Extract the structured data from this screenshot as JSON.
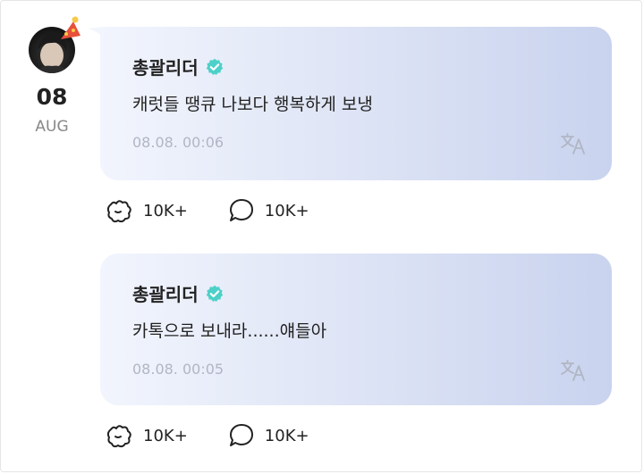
{
  "profile": {
    "date_day": "08",
    "date_month": "AUG"
  },
  "posts": [
    {
      "author": "총괄리더",
      "message": "캐럿들 땡큐 나보다 행복하게 보냉",
      "timestamp": "08.08. 00:06",
      "likes": "10K+",
      "comments": "10K+"
    },
    {
      "author": "총괄리더",
      "message": "카톡으로 보내라......얘들아",
      "timestamp": "08.08. 00:05",
      "likes": "10K+",
      "comments": "10K+"
    }
  ],
  "icons": {
    "verified": "verified-badge-icon",
    "translate": "translate-icon",
    "like": "like-icon",
    "comment": "comment-icon",
    "party_hat": "party-hat-icon"
  },
  "colors": {
    "verified": "#4dd0c8",
    "bubble_start": "#f2f5fd",
    "bubble_end": "#c9d3ee",
    "timestamp": "#b0b6c4"
  }
}
